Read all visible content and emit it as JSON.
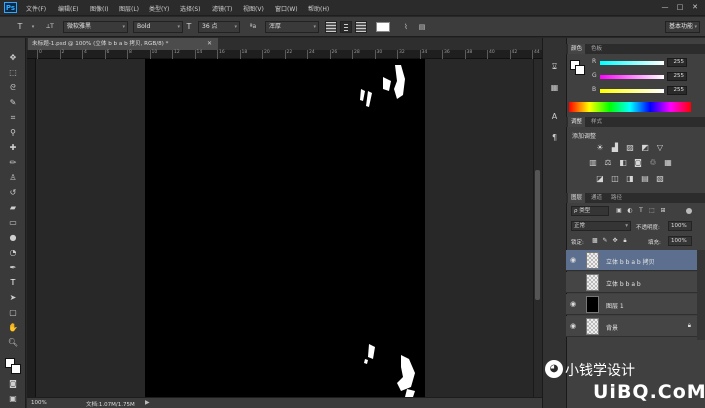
{
  "app": {
    "logo": "Ps"
  },
  "menu": [
    "文件(F)",
    "编辑(E)",
    "图像(I)",
    "图层(L)",
    "类型(Y)",
    "选择(S)",
    "滤镜(T)",
    "视图(V)",
    "窗口(W)",
    "帮助(H)"
  ],
  "window_controls": {
    "minimize": "—",
    "maximize": "□",
    "close": "✕"
  },
  "options_bar": {
    "tool_icon": "T",
    "orient_icon": "⟂T",
    "font_family": "微软雅黑",
    "font_style": "Bold",
    "size_icon": "T",
    "font_size": "36 点",
    "aa_icon": "ªa",
    "anti_alias": "浑厚",
    "color_swatch": "#ffffff",
    "workspace": "基本功能"
  },
  "document": {
    "tab_title": "未标题-1.psd @ 100% (立体 b  b  a  b 拷贝, RGB/8) *",
    "ruler_numbers": [
      "0",
      "2",
      "4",
      "6",
      "8",
      "10",
      "12",
      "14",
      "16",
      "18",
      "20",
      "22",
      "24",
      "26",
      "28",
      "30",
      "32",
      "34",
      "36",
      "38",
      "40",
      "42",
      "44"
    ],
    "zoom": "100%",
    "doc_info": "文档:1.07M/1.75M",
    "canvas_color": "#000000"
  },
  "panels": {
    "color": {
      "tabs": [
        "颜色",
        "色板"
      ],
      "channels": [
        {
          "label": "R",
          "value": "255"
        },
        {
          "label": "G",
          "value": "255"
        },
        {
          "label": "B",
          "value": "255"
        }
      ]
    },
    "adjustments": {
      "tabs": [
        "调整",
        "样式"
      ],
      "title": "添加调整"
    },
    "layers": {
      "tabs": [
        "图层",
        "通道",
        "路径"
      ],
      "filter_kind": "ρ 类型",
      "blend_mode": "正常",
      "opacity_label": "不透明度:",
      "opacity": "100%",
      "lock_label": "锁定:",
      "fill_label": "填充:",
      "fill": "100%",
      "items": [
        {
          "name": "立体 b  b  a  b 拷贝",
          "selected": true,
          "visible": true,
          "thumb": "text"
        },
        {
          "name": "立体 b  b  a  b",
          "selected": false,
          "visible": false,
          "thumb": "text"
        },
        {
          "name": "图层 1",
          "selected": false,
          "visible": true,
          "thumb": "black"
        },
        {
          "name": "背景",
          "selected": false,
          "visible": true,
          "thumb": "checker",
          "locked": true
        }
      ]
    }
  },
  "watermark": {
    "line1": "小钱学设计",
    "line2": "UiBQ.CoM"
  },
  "colors": {
    "accent": "#31a8ff",
    "selected_row": "#5c6f8e",
    "panel_bg": "#404040"
  }
}
